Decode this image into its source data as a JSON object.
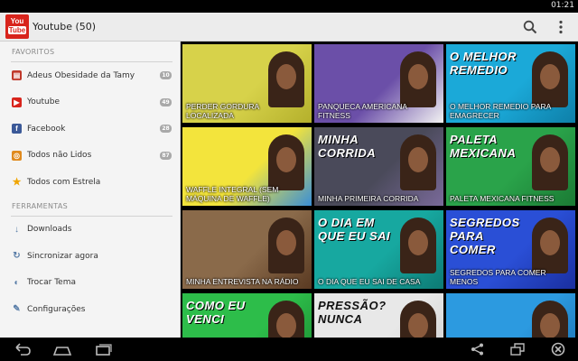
{
  "status_bar": {
    "time": "01:21"
  },
  "action_bar": {
    "logo_line1": "You",
    "logo_line2": "Tube",
    "title": "Youtube (50)",
    "search_icon": "search-icon",
    "overflow_icon": "overflow-menu-icon"
  },
  "drawer": {
    "favorites_header": "FAVORITOS",
    "favorites": [
      {
        "label": "Adeus Obesidade da Tamy",
        "count": "10",
        "icon": "feed-icon",
        "color": "#c0392b"
      },
      {
        "label": "Youtube",
        "count": "49",
        "icon": "youtube-icon",
        "color": "#d8241c"
      },
      {
        "label": "Facebook",
        "count": "28",
        "icon": "facebook-icon",
        "color": "#3b5998"
      },
      {
        "label": "Todos não Lidos",
        "count": "87",
        "icon": "unread-icon",
        "color": "#e08a1e"
      },
      {
        "label": "Todos com Estrela",
        "count": "",
        "icon": "star-icon",
        "color": "#f0a500"
      }
    ],
    "tools_header": "FERRAMENTAS",
    "tools": [
      {
        "label": "Downloads",
        "icon": "download-icon"
      },
      {
        "label": "Sincronizar agora",
        "icon": "sync-icon"
      },
      {
        "label": "Trocar Tema",
        "icon": "theme-icon"
      },
      {
        "label": "Configurações",
        "icon": "settings-icon"
      }
    ]
  },
  "videos": [
    {
      "title": "PERDER GORDURA LOCALIZADA",
      "bg": "#d7d24a",
      "bg2": "#b4b02c"
    },
    {
      "title": "PANQUECA AMERICANA FITNESS",
      "bg": "#6b4fa8",
      "bg2": "#f2f2f2"
    },
    {
      "title": "O MELHOR REMEDIO PARA EMAGRECER",
      "bg": "#1ba9d8",
      "bg2": "#0e7fa8",
      "big": "O MELHOR REMEDIO"
    },
    {
      "title": "WAFFLE INTEGRAL (SEM MÁQUINA DE WAFFLE)",
      "bg": "#f3e43c",
      "bg2": "#3a8fd6"
    },
    {
      "title": "MINHA PRIMEIRA CORRIDA",
      "bg": "#4a4a5a",
      "bg2": "#7a6a9a",
      "big": "MINHA CORRIDA"
    },
    {
      "title": "PALETA MEXICANA FITNESS",
      "bg": "#2aa34a",
      "bg2": "#1b7a34",
      "big": "PALETA MEXICANA"
    },
    {
      "title": "MINHA ENTREVISTA NA RÁDIO",
      "bg": "#8a6a4a",
      "bg2": "#5a3a22"
    },
    {
      "title": "O DIA QUE EU SAI DE CASA",
      "bg": "#17a8a0",
      "bg2": "#0d7a74",
      "big": "O DIA EM QUE EU SAI"
    },
    {
      "title": "SEGREDOS PARA COMER MENOS",
      "bg": "#2a4fd6",
      "bg2": "#1a2fa0",
      "big": "SEGREDOS PARA COMER"
    },
    {
      "title": "",
      "bg": "#2dbd4a",
      "bg2": "#1b8a30",
      "big": "COMO EU VENCI"
    },
    {
      "title": "",
      "bg": "#e8e8e8",
      "bg2": "#cfcfcf",
      "big": "PRESSÃO? NUNCA"
    },
    {
      "title": "",
      "bg": "#2c9ae0",
      "bg2": "#1a6fb0"
    }
  ],
  "nav_bar": {
    "back_icon": "back-icon",
    "home_icon": "home-icon",
    "recents_icon": "recent-apps-icon",
    "share_icon": "share-icon",
    "window_icon": "window-icon",
    "close_icon": "close-circle-icon"
  }
}
